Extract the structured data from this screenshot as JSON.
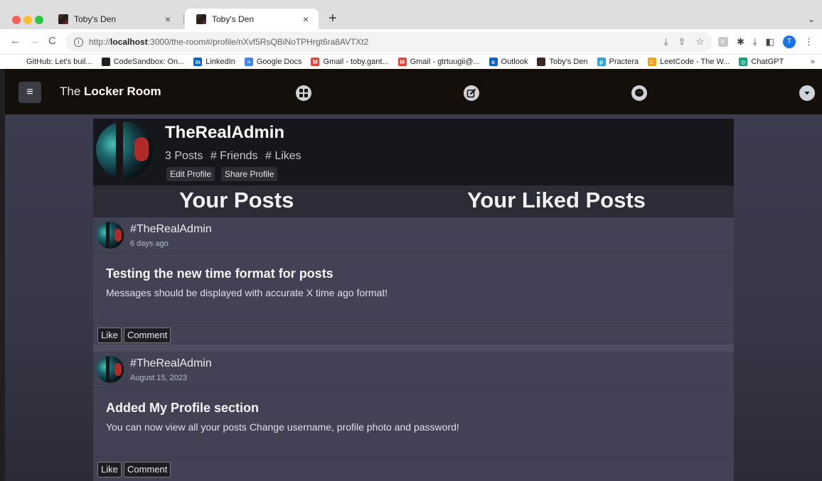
{
  "browser": {
    "tabs": [
      {
        "title": "Toby's Den",
        "close": "×"
      },
      {
        "title": "Toby's Den",
        "close": "×"
      }
    ],
    "new_tab": "+",
    "tab_menu": "⌄",
    "nav": {
      "back": "←",
      "forward": "→",
      "reload": "C"
    },
    "url_prefix": "http://",
    "url_host": "localhost",
    "url_rest": ":3000/the-room#/profile/nXvf5RsQBiNoTPHrgt6ra8AVTXt2",
    "profile_initial": "T",
    "bookmarks": [
      {
        "label": "GitHub: Let's buil...",
        "icon": "github-icon",
        "color": "#1f1f1f"
      },
      {
        "label": "CodeSandbox: On...",
        "icon": "codesandbox-icon",
        "color": "#1f1f1f"
      },
      {
        "label": "LinkedIn",
        "icon": "linkedin-icon",
        "color": "#0a66c2",
        "glyph": "in"
      },
      {
        "label": "Google Docs",
        "icon": "google-docs-icon",
        "color": "#4285f4",
        "glyph": "≡"
      },
      {
        "label": "Gmail - toby.gant...",
        "icon": "gmail-icon",
        "color": "#ea4335",
        "glyph": "M"
      },
      {
        "label": "Gmail - gtrtuugii@...",
        "icon": "gmail-icon",
        "color": "#ea4335",
        "glyph": "M"
      },
      {
        "label": "Outlook",
        "icon": "outlook-icon",
        "color": "#0a64c8",
        "glyph": "o"
      },
      {
        "label": "Toby's Den",
        "icon": "tobys-den-icon",
        "color": "#3a2a20"
      },
      {
        "label": "Practera",
        "icon": "practera-icon",
        "color": "#2fa4d9",
        "glyph": "p"
      },
      {
        "label": "LeetCode - The W...",
        "icon": "leetcode-icon",
        "color": "#f89f1b",
        "glyph": "L"
      },
      {
        "label": "ChatGPT",
        "icon": "chatgpt-icon",
        "color": "#10a37f",
        "glyph": "◎"
      }
    ],
    "bookmarks_more": "»"
  },
  "app": {
    "menu_glyph": "≡",
    "brand_prefix": "The ",
    "brand_bold": "Locker Room",
    "nav_icons": [
      "grid-icon",
      "edit-icon",
      "messenger-icon",
      "caret-down-icon"
    ]
  },
  "profile": {
    "username": "TheRealAdmin",
    "posts_stat": "3 Posts",
    "friends_stat": "# Friends",
    "likes_stat": "# Likes",
    "edit_label": "Edit Profile",
    "share_label": "Share Profile"
  },
  "sections": {
    "posts": "Your Posts",
    "liked": "Your Liked Posts"
  },
  "posts": [
    {
      "author": "#TheRealAdmin",
      "time": "6 days ago",
      "title": "Testing the new time format for posts",
      "body": "Messages should be displayed with accurate X time ago format!",
      "like_label": "Like",
      "comment_label": "Comment"
    },
    {
      "author": "#TheRealAdmin",
      "time": "August 15, 2023",
      "title": "Added My Profile section",
      "body": "You can now view all your posts Change username, profile photo and password!",
      "like_label": "Like",
      "comment_label": "Comment"
    }
  ]
}
